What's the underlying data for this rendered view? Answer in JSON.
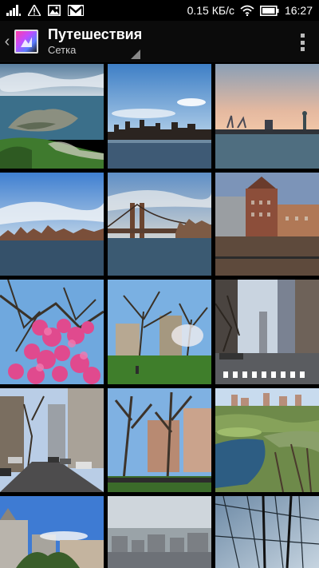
{
  "status_bar": {
    "speed": "0.15 КБ/с",
    "time": "16:27",
    "icons": [
      "signal-icon",
      "warning-icon",
      "image-notification-icon",
      "gmail-icon",
      "wifi-icon",
      "battery-icon"
    ]
  },
  "action_bar": {
    "title": "Путешествия",
    "subtitle": "Сетка",
    "icons": [
      "back-chevron-icon",
      "album-thumbnail-icon",
      "overflow-menu-icon"
    ]
  },
  "grid": {
    "columns": 3,
    "photos": [
      {
        "name": "coast-island"
      },
      {
        "name": "skyline-water"
      },
      {
        "name": "harbor-statue"
      },
      {
        "name": "skyline-clouds"
      },
      {
        "name": "bridge"
      },
      {
        "name": "buildings"
      },
      {
        "name": "pink-blossoms"
      },
      {
        "name": "park-trees"
      },
      {
        "name": "city-street"
      },
      {
        "name": "residential-street"
      },
      {
        "name": "bare-trees-park"
      },
      {
        "name": "park-lake"
      },
      {
        "name": "castle-blue-sky"
      },
      {
        "name": "city-haze"
      },
      {
        "name": "bridge-cables"
      }
    ]
  },
  "colors": {
    "background": "#000000",
    "action_bar": "#0b0b0b"
  }
}
